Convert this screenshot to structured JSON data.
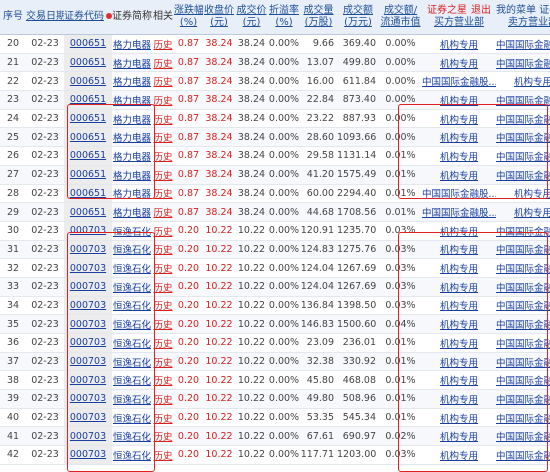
{
  "header": {
    "idx": "序号",
    "date": "交易日期",
    "code": "证券代码",
    "name": "证券简称",
    "rel": "相关",
    "change_1": "涨跌幅",
    "change_2": "(%)",
    "close_1": "收盘价",
    "close_2": "(元)",
    "price_1": "成交价",
    "price_2": "(元)",
    "disc_1": "折溢率",
    "disc_2": "(%)",
    "vol_1": "成交量",
    "vol_2": "(万股)",
    "amt_1": "成交额",
    "amt_2": "(万元)",
    "ratio_1": "成交额/",
    "ratio_2": "流通市值",
    "fav": "证券之星",
    "logout": "退出",
    "buy": "买方营业部",
    "mymenu": "我的菜单",
    "trade": "证券交易",
    "sell": "卖方营业部"
  },
  "rows": [
    {
      "i": "20",
      "d": "02-23",
      "c": "000651",
      "n": "格力电器",
      "h": "历史",
      "p": "0.87",
      "cl": "38.24",
      "t": "38.24",
      "z": "0.00%",
      "v": "9.66",
      "a": "369.40",
      "r": "0.00%",
      "b": "机构专用",
      "s": "中国国际金融股..."
    },
    {
      "i": "21",
      "d": "02-23",
      "c": "000651",
      "n": "格力电器",
      "h": "历史",
      "p": "0.87",
      "cl": "38.24",
      "t": "38.24",
      "z": "0.00%",
      "v": "13.07",
      "a": "499.80",
      "r": "0.00%",
      "b": "机构专用",
      "s": "中国国际金融股..."
    },
    {
      "i": "22",
      "d": "02-23",
      "c": "000651",
      "n": "格力电器",
      "h": "历史",
      "p": "0.87",
      "cl": "38.24",
      "t": "38.24",
      "z": "0.00%",
      "v": "16.00",
      "a": "611.84",
      "r": "0.00%",
      "b": "中国国际金融股...",
      "s": "机构专用"
    },
    {
      "i": "23",
      "d": "02-23",
      "c": "000651",
      "n": "格力电器",
      "h": "历史",
      "p": "0.87",
      "cl": "38.24",
      "t": "38.24",
      "z": "0.00%",
      "v": "22.84",
      "a": "873.40",
      "r": "0.00%",
      "b": "机构专用",
      "s": "中国国际金融股..."
    },
    {
      "i": "24",
      "d": "02-23",
      "c": "000651",
      "n": "格力电器",
      "h": "历史",
      "p": "0.87",
      "cl": "38.24",
      "t": "38.24",
      "z": "0.00%",
      "v": "23.22",
      "a": "887.93",
      "r": "0.00%",
      "b": "机构专用",
      "s": "中国国际金融股..."
    },
    {
      "i": "25",
      "d": "02-23",
      "c": "000651",
      "n": "格力电器",
      "h": "历史",
      "p": "0.87",
      "cl": "38.24",
      "t": "38.24",
      "z": "0.00%",
      "v": "28.60",
      "a": "1093.66",
      "r": "0.00%",
      "b": "机构专用",
      "s": "中国国际金融股..."
    },
    {
      "i": "26",
      "d": "02-23",
      "c": "000651",
      "n": "格力电器",
      "h": "历史",
      "p": "0.87",
      "cl": "38.24",
      "t": "38.24",
      "z": "0.00%",
      "v": "29.58",
      "a": "1131.14",
      "r": "0.01%",
      "b": "机构专用",
      "s": "中国国际金融股..."
    },
    {
      "i": "27",
      "d": "02-23",
      "c": "000651",
      "n": "格力电器",
      "h": "历史",
      "p": "0.87",
      "cl": "38.24",
      "t": "38.24",
      "z": "0.00%",
      "v": "41.20",
      "a": "1575.49",
      "r": "0.01%",
      "b": "机构专用",
      "s": "中国国际金融股..."
    },
    {
      "i": "28",
      "d": "02-23",
      "c": "000651",
      "n": "格力电器",
      "h": "历史",
      "p": "0.87",
      "cl": "38.24",
      "t": "38.24",
      "z": "0.00%",
      "v": "60.00",
      "a": "2294.40",
      "r": "0.01%",
      "b": "中国国际金融股...",
      "s": "机构专用"
    },
    {
      "i": "29",
      "d": "02-23",
      "c": "000651",
      "n": "格力电器",
      "h": "历史",
      "p": "0.87",
      "cl": "38.24",
      "t": "38.24",
      "z": "0.00%",
      "v": "44.68",
      "a": "1708.56",
      "r": "0.01%",
      "b": "中国国际金融股...",
      "s": "机构专用"
    },
    {
      "i": "30",
      "d": "02-23",
      "c": "000703",
      "n": "恒逸石化",
      "h": "历史",
      "p": "0.20",
      "cl": "10.22",
      "t": "10.22",
      "z": "0.00%",
      "v": "120.91",
      "a": "1235.70",
      "r": "0.03%",
      "b": "机构专用",
      "s": "中国国际金融股..."
    },
    {
      "i": "31",
      "d": "02-23",
      "c": "000703",
      "n": "恒逸石化",
      "h": "历史",
      "p": "0.20",
      "cl": "10.22",
      "t": "10.22",
      "z": "0.00%",
      "v": "124.83",
      "a": "1275.76",
      "r": "0.03%",
      "b": "机构专用",
      "s": "中国国际金融股..."
    },
    {
      "i": "32",
      "d": "02-23",
      "c": "000703",
      "n": "恒逸石化",
      "h": "历史",
      "p": "0.20",
      "cl": "10.22",
      "t": "10.22",
      "z": "0.00%",
      "v": "124.04",
      "a": "1267.69",
      "r": "0.03%",
      "b": "机构专用",
      "s": "中国国际金融股..."
    },
    {
      "i": "33",
      "d": "02-23",
      "c": "000703",
      "n": "恒逸石化",
      "h": "历史",
      "p": "0.20",
      "cl": "10.22",
      "t": "10.22",
      "z": "0.00%",
      "v": "124.04",
      "a": "1267.69",
      "r": "0.03%",
      "b": "机构专用",
      "s": "中国国际金融股..."
    },
    {
      "i": "34",
      "d": "02-23",
      "c": "000703",
      "n": "恒逸石化",
      "h": "历史",
      "p": "0.20",
      "cl": "10.22",
      "t": "10.22",
      "z": "0.00%",
      "v": "136.84",
      "a": "1398.50",
      "r": "0.03%",
      "b": "机构专用",
      "s": "中国国际金融股..."
    },
    {
      "i": "35",
      "d": "02-23",
      "c": "000703",
      "n": "恒逸石化",
      "h": "历史",
      "p": "0.20",
      "cl": "10.22",
      "t": "10.22",
      "z": "0.00%",
      "v": "146.83",
      "a": "1500.60",
      "r": "0.04%",
      "b": "机构专用",
      "s": "中国国际金融股..."
    },
    {
      "i": "36",
      "d": "02-23",
      "c": "000703",
      "n": "恒逸石化",
      "h": "历史",
      "p": "0.20",
      "cl": "10.22",
      "t": "10.22",
      "z": "0.00%",
      "v": "23.09",
      "a": "236.01",
      "r": "0.01%",
      "b": "机构专用",
      "s": "中国国际金融股..."
    },
    {
      "i": "37",
      "d": "02-23",
      "c": "000703",
      "n": "恒逸石化",
      "h": "历史",
      "p": "0.20",
      "cl": "10.22",
      "t": "10.22",
      "z": "0.00%",
      "v": "32.38",
      "a": "330.92",
      "r": "0.01%",
      "b": "机构专用",
      "s": "中国国际金融股..."
    },
    {
      "i": "38",
      "d": "02-23",
      "c": "000703",
      "n": "恒逸石化",
      "h": "历史",
      "p": "0.20",
      "cl": "10.22",
      "t": "10.22",
      "z": "0.00%",
      "v": "45.80",
      "a": "468.08",
      "r": "0.01%",
      "b": "机构专用",
      "s": "中国国际金融股..."
    },
    {
      "i": "39",
      "d": "02-23",
      "c": "000703",
      "n": "恒逸石化",
      "h": "历史",
      "p": "0.20",
      "cl": "10.22",
      "t": "10.22",
      "z": "0.00%",
      "v": "49.80",
      "a": "508.96",
      "r": "0.01%",
      "b": "机构专用",
      "s": "中国国际金融股..."
    },
    {
      "i": "40",
      "d": "02-23",
      "c": "000703",
      "n": "恒逸石化",
      "h": "历史",
      "p": "0.20",
      "cl": "10.22",
      "t": "10.22",
      "z": "0.00%",
      "v": "53.35",
      "a": "545.34",
      "r": "0.01%",
      "b": "机构专用",
      "s": "中国国际金融股..."
    },
    {
      "i": "41",
      "d": "02-23",
      "c": "000703",
      "n": "恒逸石化",
      "h": "历史",
      "p": "0.20",
      "cl": "10.22",
      "t": "10.22",
      "z": "0.00%",
      "v": "67.61",
      "a": "690.97",
      "r": "0.02%",
      "b": "机构专用",
      "s": "中国国际金融股..."
    },
    {
      "i": "42",
      "d": "02-23",
      "c": "000703",
      "n": "恒逸石化",
      "h": "历史",
      "p": "0.20",
      "cl": "10.22",
      "t": "10.22",
      "z": "0.00%",
      "v": "117.71",
      "a": "1203.00",
      "r": "0.03%",
      "b": "机构专用",
      "s": "中国国际金融股..."
    }
  ],
  "colors": {
    "accent_red": "#e02020",
    "link_blue": "#1a3fa0",
    "header_bg": "#e8eff8"
  },
  "icons": {
    "sort_marker": "red-dot-icon"
  }
}
